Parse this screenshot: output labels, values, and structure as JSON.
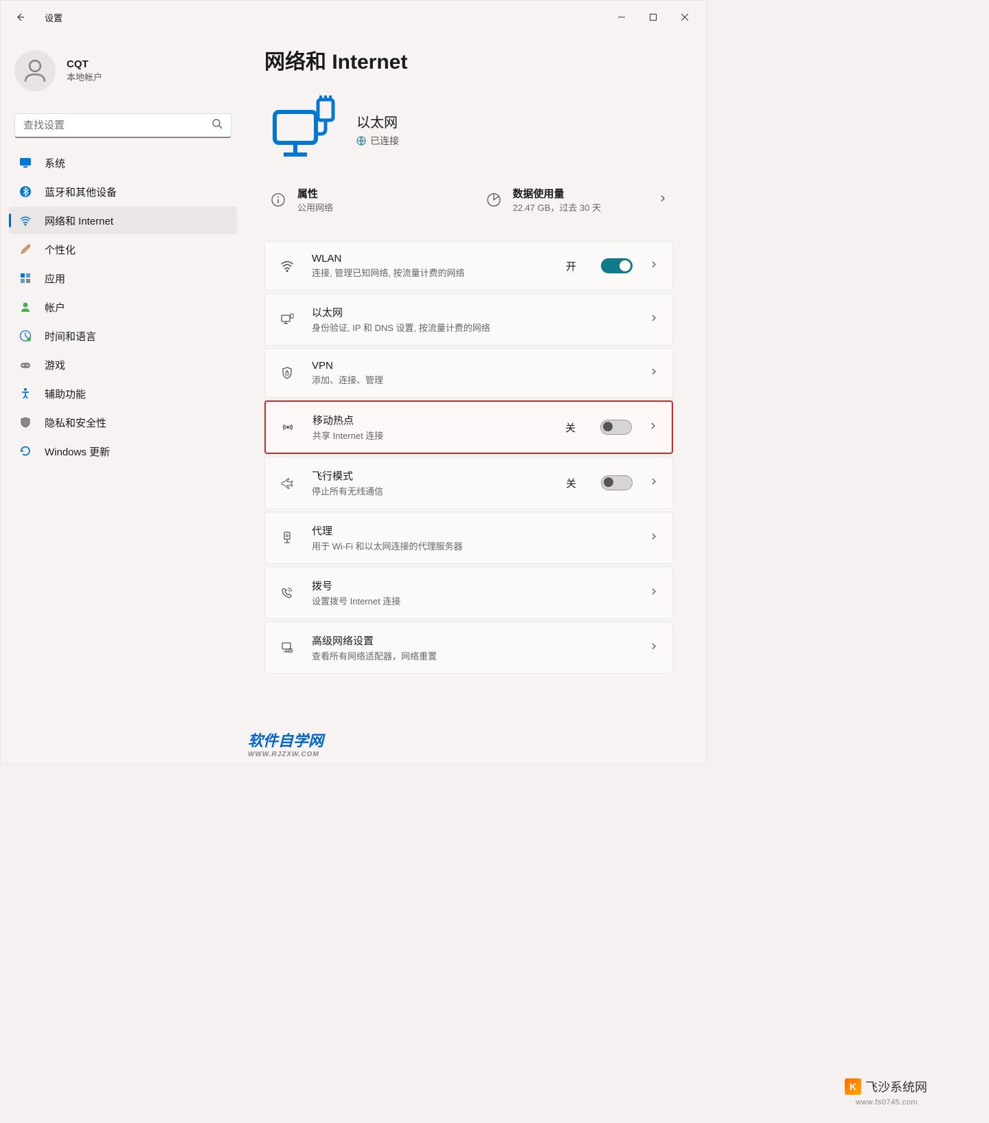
{
  "window": {
    "title": "设置"
  },
  "user": {
    "name": "CQT",
    "account": "本地帐户"
  },
  "search": {
    "placeholder": "查找设置"
  },
  "sidebar": {
    "items": [
      {
        "label": "系统",
        "icon": "system"
      },
      {
        "label": "蓝牙和其他设备",
        "icon": "bluetooth"
      },
      {
        "label": "网络和 Internet",
        "icon": "network",
        "active": true
      },
      {
        "label": "个性化",
        "icon": "personalize"
      },
      {
        "label": "应用",
        "icon": "apps"
      },
      {
        "label": "帐户",
        "icon": "accounts"
      },
      {
        "label": "时间和语言",
        "icon": "time"
      },
      {
        "label": "游戏",
        "icon": "gaming"
      },
      {
        "label": "辅助功能",
        "icon": "accessibility"
      },
      {
        "label": "隐私和安全性",
        "icon": "privacy"
      },
      {
        "label": "Windows 更新",
        "icon": "update"
      }
    ]
  },
  "page": {
    "title": "网络和 Internet"
  },
  "status": {
    "title": "以太网",
    "subtitle": "已连接"
  },
  "info_cards": {
    "properties": {
      "title": "属性",
      "subtitle": "公用网络"
    },
    "data_usage": {
      "title": "数据使用量",
      "subtitle": "22.47 GB，过去 30 天"
    }
  },
  "settings": {
    "wlan": {
      "title": "WLAN",
      "desc": "连接, 管理已知网络, 按流量计费的网络",
      "toggle_label": "开",
      "toggle_state": "on"
    },
    "ethernet": {
      "title": "以太网",
      "desc": "身份验证, IP 和 DNS 设置, 按流量计费的网络"
    },
    "vpn": {
      "title": "VPN",
      "desc": "添加、连接、管理"
    },
    "hotspot": {
      "title": "移动热点",
      "desc": "共享 Internet 连接",
      "toggle_label": "关",
      "toggle_state": "off"
    },
    "airplane": {
      "title": "飞行模式",
      "desc": "停止所有无线通信",
      "toggle_label": "关",
      "toggle_state": "off"
    },
    "proxy": {
      "title": "代理",
      "desc": "用于 Wi-Fi 和以太网连接的代理服务器"
    },
    "dialup": {
      "title": "拨号",
      "desc": "设置拨号 Internet 连接"
    },
    "advanced": {
      "title": "高级网络设置",
      "desc": "查看所有网络适配器，网络重置"
    }
  },
  "watermarks": {
    "wm1": "软件自学网",
    "wm1_sub": "WWW.RJZXW.COM",
    "wm2": "飞沙系统网",
    "wm2_sub": "www.fs0745.com"
  }
}
